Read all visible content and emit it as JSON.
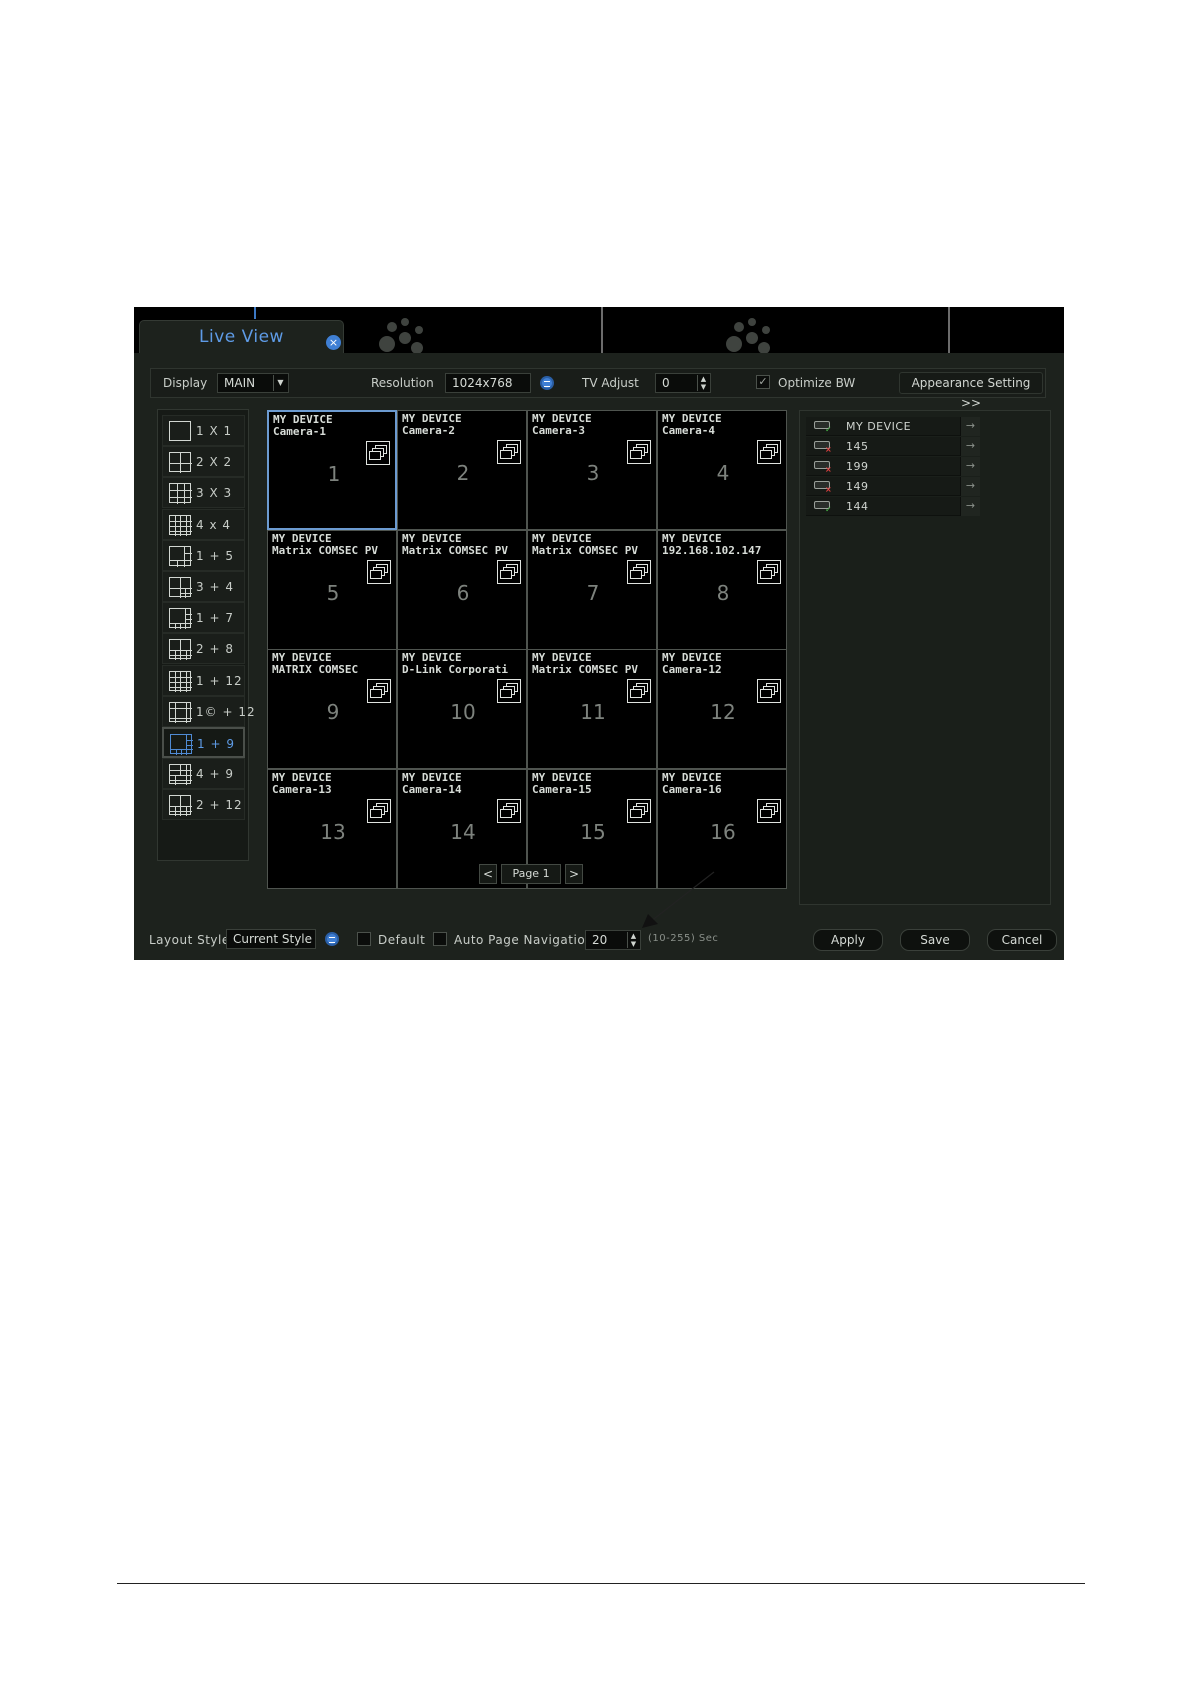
{
  "tab": {
    "title": "Live View",
    "close_icon": "close-icon"
  },
  "toolbar": {
    "display_label": "Display",
    "display_value": "MAIN",
    "resolution_label": "Resolution",
    "resolution_value": "1024x768",
    "tv_adjust_label": "TV Adjust",
    "tv_adjust_value": "0",
    "optimize_label": "Optimize BW",
    "optimize_checked": true,
    "appearance_label": "Appearance Setting >>"
  },
  "layouts": [
    {
      "label": "1 X 1"
    },
    {
      "label": "2 X 2"
    },
    {
      "label": "3 X 3"
    },
    {
      "label": "4 x 4"
    },
    {
      "label": "1 + 5"
    },
    {
      "label": "3 + 4"
    },
    {
      "label": "1 + 7"
    },
    {
      "label": "2 + 8"
    },
    {
      "label": "1 + 12"
    },
    {
      "label": "1© + 12"
    },
    {
      "label": "1 + 9",
      "selected": true
    },
    {
      "label": "4 + 9"
    },
    {
      "label": "2 + 12"
    }
  ],
  "cells": [
    {
      "device": "MY DEVICE",
      "camera": "Camera-1",
      "number": "1"
    },
    {
      "device": "MY DEVICE",
      "camera": "Camera-2",
      "number": "2"
    },
    {
      "device": "MY DEVICE",
      "camera": "Camera-3",
      "number": "3"
    },
    {
      "device": "MY DEVICE",
      "camera": "Camera-4",
      "number": "4"
    },
    {
      "device": "MY DEVICE",
      "camera": "Matrix COMSEC PV",
      "number": "5"
    },
    {
      "device": "MY DEVICE",
      "camera": "Matrix COMSEC PV",
      "number": "6"
    },
    {
      "device": "MY DEVICE",
      "camera": "Matrix COMSEC PV",
      "number": "7"
    },
    {
      "device": "MY DEVICE",
      "camera": "192.168.102.147",
      "number": "8"
    },
    {
      "device": "MY DEVICE",
      "camera": "MATRIX COMSEC",
      "number": "9"
    },
    {
      "device": "MY DEVICE",
      "camera": "D-Link Corporati",
      "number": "10"
    },
    {
      "device": "MY DEVICE",
      "camera": "Matrix COMSEC PV",
      "number": "11"
    },
    {
      "device": "MY DEVICE",
      "camera": "Camera-12",
      "number": "12"
    },
    {
      "device": "MY DEVICE",
      "camera": "Camera-13",
      "number": "13"
    },
    {
      "device": "MY DEVICE",
      "camera": "Camera-14",
      "number": "14"
    },
    {
      "device": "MY DEVICE",
      "camera": "Camera-15",
      "number": "15"
    },
    {
      "device": "MY DEVICE",
      "camera": "Camera-16",
      "number": "16"
    }
  ],
  "pager": {
    "label": "Page 1",
    "prev": "<",
    "next": ">"
  },
  "devices": [
    {
      "name": "MY DEVICE",
      "status": "online"
    },
    {
      "name": "145",
      "status": "offline"
    },
    {
      "name": "199",
      "status": "offline"
    },
    {
      "name": "149",
      "status": "offline"
    },
    {
      "name": "144",
      "status": "online"
    }
  ],
  "bottom": {
    "layout_style_label": "Layout Style",
    "layout_style_value": "Current Style",
    "default_label": "Default",
    "auto_nav_label": "Auto Page Navigation",
    "auto_nav_value": "20",
    "range_label": "(10-255) Sec",
    "apply": "Apply",
    "save": "Save",
    "cancel": "Cancel"
  },
  "colors": {
    "accent": "#3f7fd4",
    "online": "#4bc24b",
    "offline": "#e04040"
  }
}
